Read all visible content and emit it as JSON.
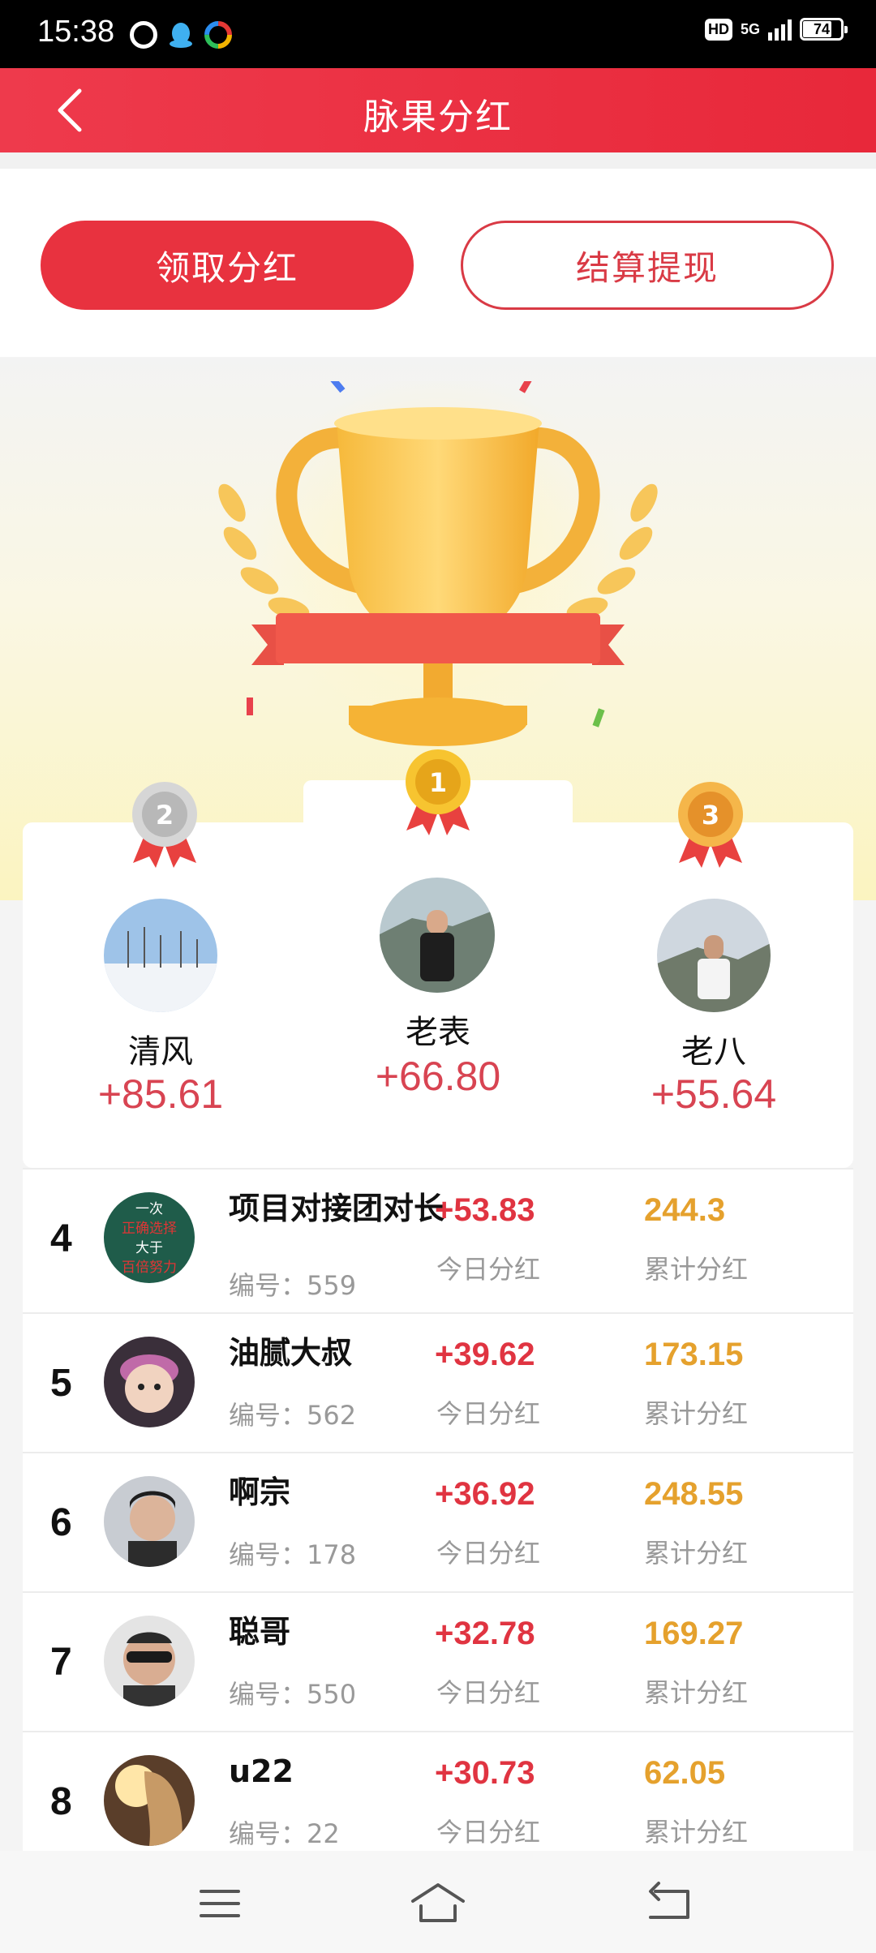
{
  "status_bar": {
    "time": "15:38",
    "hd": "HD",
    "network": "5G",
    "battery": "74"
  },
  "header": {
    "title": "脉果分红",
    "back_icon": "chevron-left-icon"
  },
  "actions": {
    "claim_label": "领取分红",
    "settle_label": "结算提现"
  },
  "podium": {
    "first": {
      "rank": "1",
      "name": "老表",
      "amount": "+66.80"
    },
    "second": {
      "rank": "2",
      "name": "清风",
      "amount": "+85.61"
    },
    "third": {
      "rank": "3",
      "name": "老八",
      "amount": "+55.64"
    }
  },
  "list": [
    {
      "rank": "4",
      "name": "项目对接团对长",
      "id": "编号：559",
      "today": "+53.83",
      "today_label": "今日分红",
      "total": "244.3",
      "total_label": "累计分红",
      "avatar_text": [
        "一次",
        "正确选择",
        "大于",
        "百倍努力"
      ]
    },
    {
      "rank": "5",
      "name": "油腻大叔",
      "id": "编号：562",
      "today": "+39.62",
      "today_label": "今日分红",
      "total": "173.15",
      "total_label": "累计分红"
    },
    {
      "rank": "6",
      "name": "啊宗",
      "id": "编号：178",
      "today": "+36.92",
      "today_label": "今日分红",
      "total": "248.55",
      "total_label": "累计分红"
    },
    {
      "rank": "7",
      "name": "聪哥",
      "id": "编号：550",
      "today": "+32.78",
      "today_label": "今日分红",
      "total": "169.27",
      "total_label": "累计分红"
    },
    {
      "rank": "8",
      "name": "u22",
      "id": "编号：22",
      "today": "+30.73",
      "today_label": "今日分红",
      "total": "62.05",
      "total_label": "累计分红"
    }
  ],
  "navbar": {
    "menu_icon": "menu-icon",
    "home_icon": "home-icon",
    "back_icon": "return-icon"
  },
  "colors": {
    "brand_red": "#e8323f",
    "amount_red": "#d84452",
    "total_gold": "#e5a12d"
  }
}
